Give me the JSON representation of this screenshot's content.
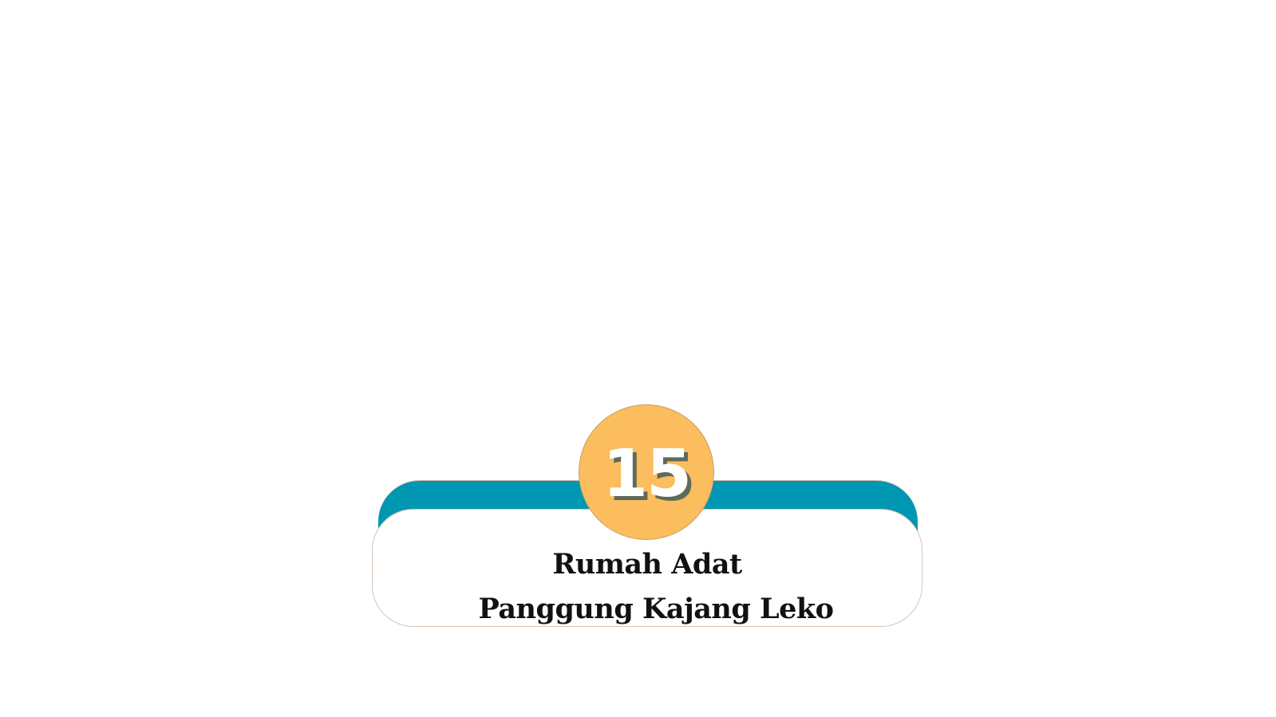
{
  "badge": {
    "number": "15"
  },
  "title": {
    "line1": "Rumah Adat",
    "line2": "Panggung Kajang Leko"
  },
  "colors": {
    "band": "#0097b2",
    "badge": "#fbbd5d",
    "background": "#ffffff",
    "text": "#111111",
    "number_shadow": "#5f6b5a"
  }
}
